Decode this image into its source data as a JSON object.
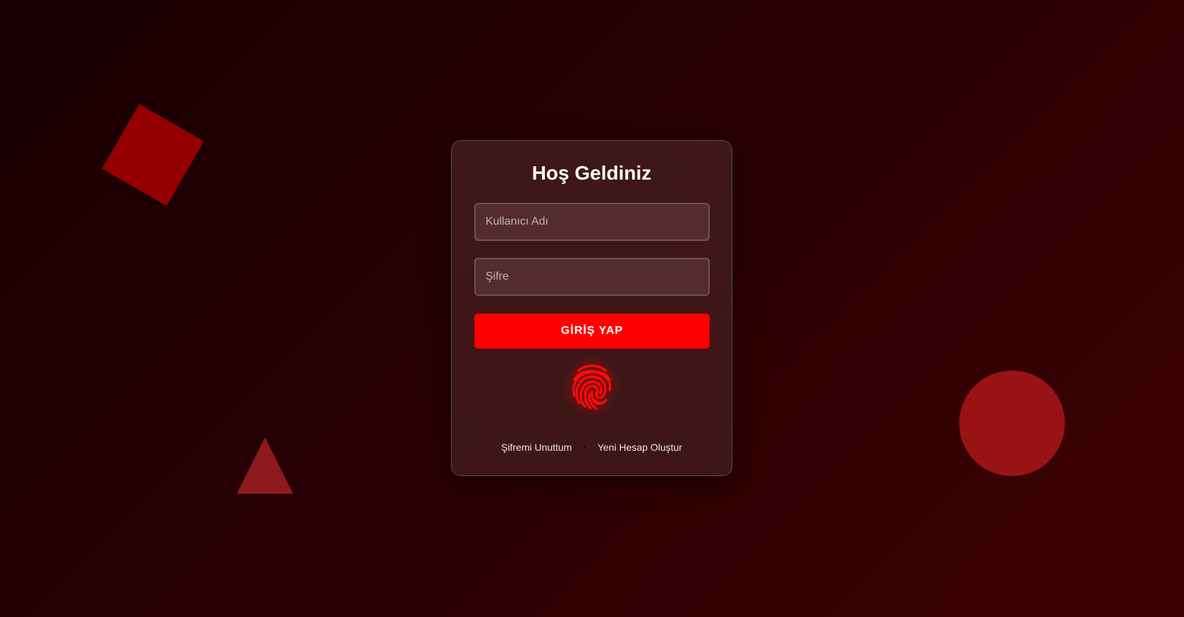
{
  "login": {
    "title": "Hoş Geldiniz",
    "username_placeholder": "Kullanıcı Adı",
    "username_value": "",
    "password_placeholder": "Şifre",
    "password_value": "",
    "submit_label": "GİRİŞ YAP",
    "fingerprint_icon": "fingerprint-icon",
    "forgot_password_label": "Şifremi Unuttum",
    "separator": "•",
    "create_account_label": "Yeni Hesap Oluştur"
  },
  "theme": {
    "accent": "#ff0000",
    "background": "#2a0003",
    "card_bg": "#431c1e"
  }
}
